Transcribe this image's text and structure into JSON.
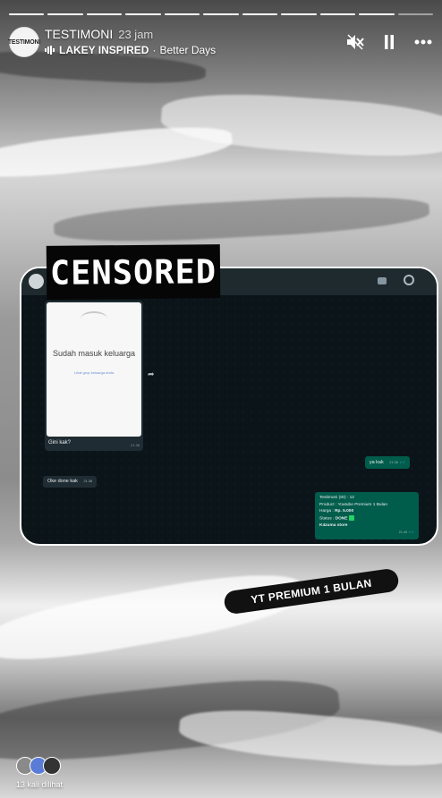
{
  "story": {
    "account": "TESTIMONI",
    "time_ago": "23 jam",
    "avatar_text": "TESTIMONI",
    "music_artist": "LAKEY INSPIRED",
    "music_separator": "·",
    "music_title": "Better Days",
    "segments_total": 11,
    "segment_current": 10,
    "views_label": "13 kali dilihat"
  },
  "chat": {
    "image_card_title": "Sudah masuk keluarga",
    "image_card_sub": "Lihat grup keluarga anda",
    "image_caption": "Gini kak?",
    "image_time": "21.38",
    "msg_out_1": "ya kak",
    "msg_out_1_time": "21.38",
    "msg_in_1": "Oke done kak",
    "msg_in_1_time": "21.38",
    "receipt": {
      "line1": "Testimoni (ID) : 12",
      "line2": "Product : Youtube Premium 1 Bulan",
      "line3_label": "Harga : ",
      "line3_value": "Rp. 5.000",
      "line4_label": "Status : ",
      "line4_value": "DONE",
      "line5": "K4zuma store",
      "time": "21.40"
    }
  },
  "stickers": {
    "censored": "CENSORED",
    "label": "YT PREMIUM 1 BULAN"
  },
  "icons": [
    "mute-icon",
    "pause-icon",
    "more-icon",
    "music-bars-icon"
  ]
}
